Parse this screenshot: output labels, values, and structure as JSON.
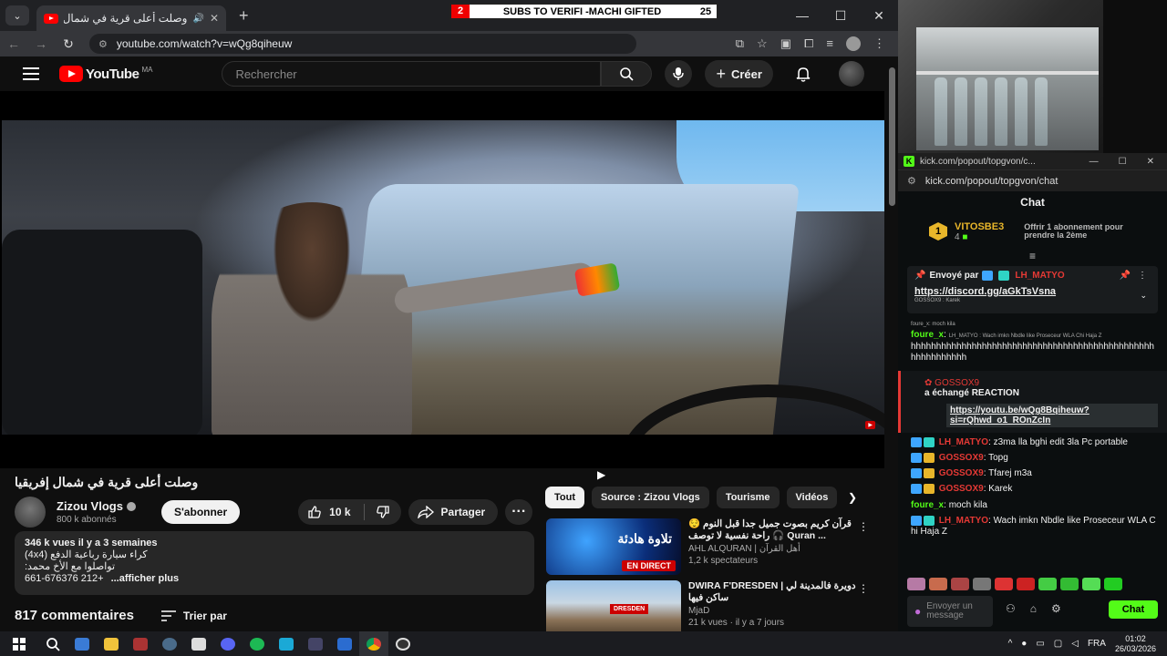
{
  "browser": {
    "tab_title": "وصلت أعلى قرية في شمال إ",
    "url": "youtube.com/watch?v=wQg8qiheuw"
  },
  "overlay": {
    "left_num": "2",
    "text": "SUBS TO VERIFI -MACHI GIFTED",
    "right_num": "25"
  },
  "youtube": {
    "logo": "YouTube",
    "region": "MA",
    "search_placeholder": "Rechercher",
    "create_label": "Créer"
  },
  "video": {
    "title": "وصلت أعلى قرية في شمال إفريقيا",
    "channel": "Zizou Vlogs",
    "subscribers": "800 k abonnés",
    "subscribe_label": "S'abonner",
    "likes": "10 k",
    "share_label": "Partager",
    "desc_meta": "346 k vues  il y a 3 semaines",
    "desc_line1": "كراء سيارة رباعية الدفع (4x4)",
    "desc_line2": "تواصلوا مع الأخ محمد:",
    "desc_phone": "661-676376 212+",
    "desc_more": "...afficher plus",
    "comments_count": "817 commentaires",
    "sort_label": "Trier par"
  },
  "chips": [
    "Tout",
    "Source : Zizou Vlogs",
    "Tourisme",
    "Vidéos"
  ],
  "related": [
    {
      "title": "قرآن كريم بصوت جميل جدا قبل النوم 😌 راحة نفسية لا توصف 🎧 Quran ...",
      "channel": "AHL ALQURAN | أهل القرآن",
      "meta": "1,2 k spectateurs",
      "thumb_text": "تلاوة هادئة",
      "badge": "EN DIRECT"
    },
    {
      "title": "DWIRA F'DRESDEN | دويرة فالمدينة لي ساكن فيها",
      "channel": "MjaD",
      "meta": "21 k vues · il y a 7 jours",
      "thumb_text": "DRESDEN"
    }
  ],
  "kick": {
    "window_title": "kick.com/popout/topgvon/c...",
    "url": "kick.com/popout/topgvon/chat",
    "header": "Chat",
    "gifter": {
      "rank": "1",
      "name": "VITOSBE3",
      "count": "4",
      "offer": "Offrir 1 abonnement pour prendre la 2ème"
    },
    "pinned": {
      "by_label": "Envoyé par",
      "user": "LH_MATYO",
      "link": "https://discord.gg/aGkTsVsna",
      "reply_meta": "foure_x: moch kila",
      "reply_user": "GOSSOX9 : Karek"
    },
    "messages": [
      {
        "user": "foure_x",
        "color": "green",
        "text": "hhhhhhhhhhhhhhhhhhhhhhhhhhhhhhhhhhhhhhhhhhhhhhhhhhhhhhhhhhh",
        "reply": "LH_MATYO : Wach imkn Nbdle like Proseceur WLA Chi Haja Z"
      },
      {
        "user": "GOSSOX9",
        "color": "red",
        "text": "a échangé REACTION",
        "link": "https://youtu.be/wQg8Bqiheuw?si=rQhwd_o1_ROnZcIn",
        "redemption": true
      },
      {
        "user": "LH_MATYO",
        "color": "red",
        "text": "z3ma lla bghi edit 3la Pc portable"
      },
      {
        "user": "GOSSOX9",
        "color": "red",
        "text": "Topg"
      },
      {
        "user": "GOSSOX9",
        "color": "red",
        "text": "Tfarej m3a"
      },
      {
        "user": "GOSSOX9",
        "color": "red",
        "text": "Karek"
      },
      {
        "user": "foure_x",
        "color": "green",
        "text": "moch kila"
      },
      {
        "user": "LH_MATYO",
        "color": "red",
        "text": "Wach imkn Nbdle like Proseceur WLA Chi Haja Z"
      }
    ],
    "input_placeholder": "Envoyer un message",
    "send_label": "Chat"
  },
  "taskbar": {
    "lang": "FRA",
    "time": "01:02",
    "date": "26/03/2026"
  },
  "colors": {
    "kick_green": "#53fc18",
    "yt_red": "#ff0000",
    "user_red": "#e53935"
  }
}
